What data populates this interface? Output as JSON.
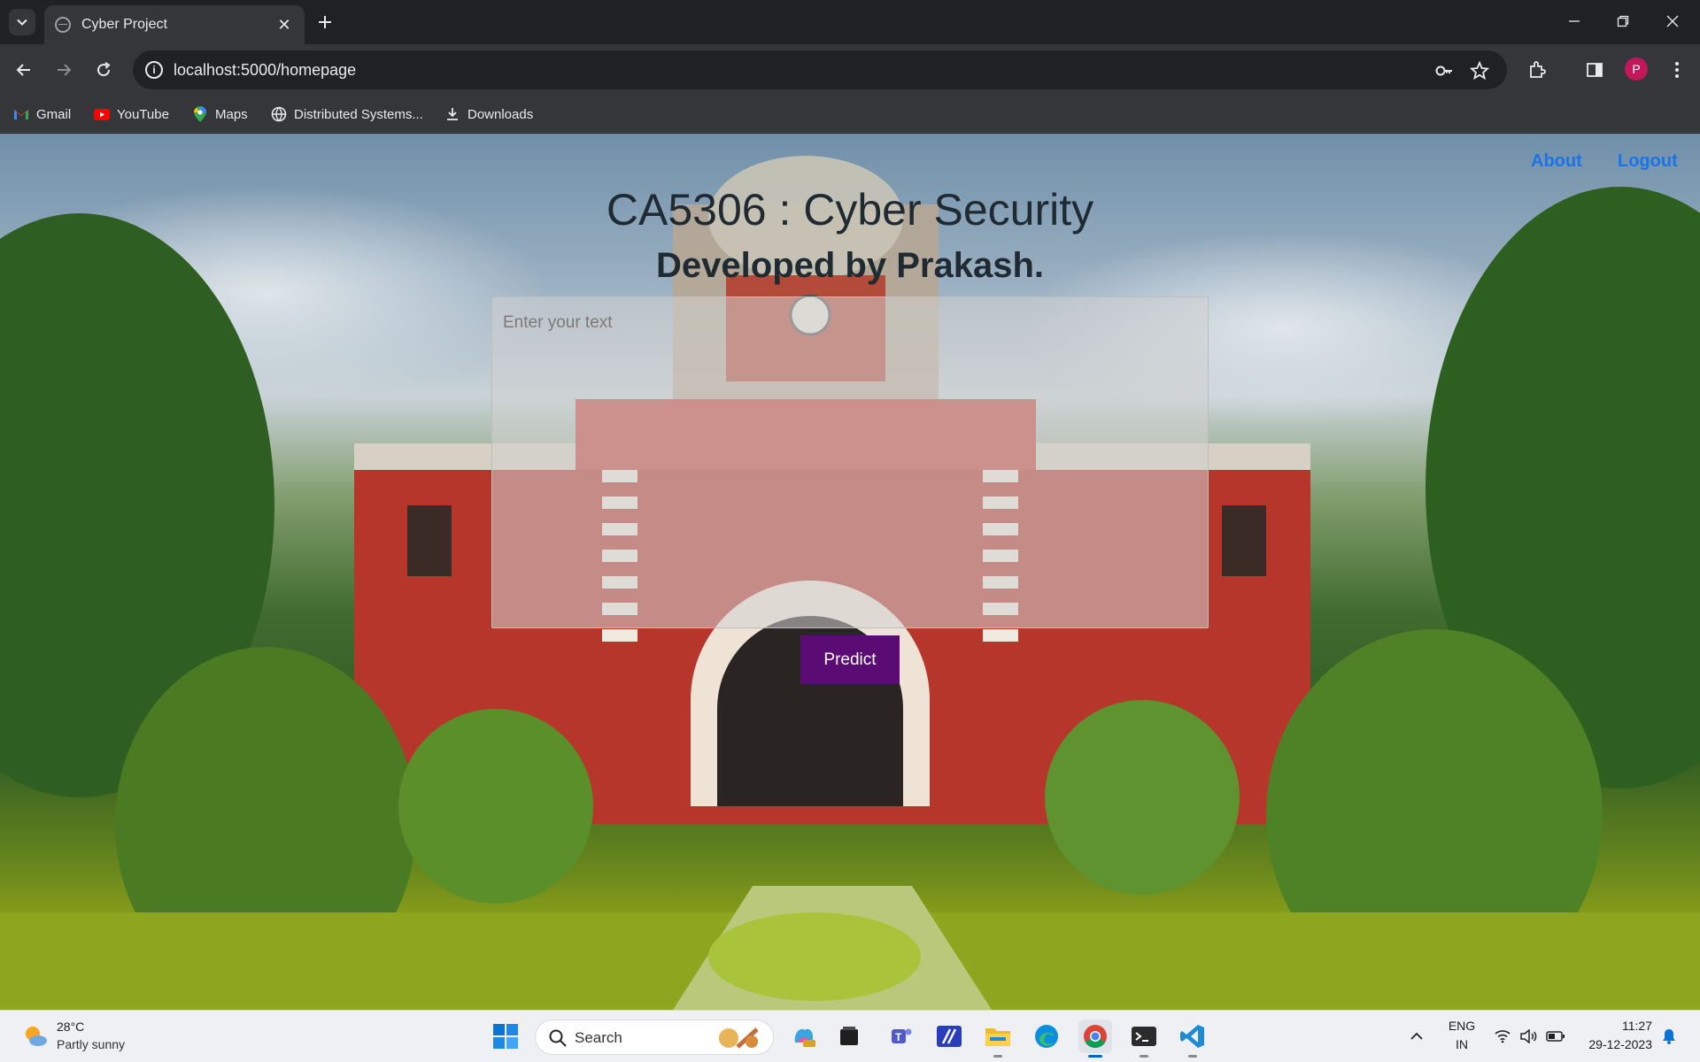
{
  "browser": {
    "tab_title": "Cyber Project",
    "url": "localhost:5000/homepage",
    "profile_initial": "P",
    "bookmarks": [
      {
        "label": "Gmail",
        "icon": "gmail-icon"
      },
      {
        "label": "YouTube",
        "icon": "youtube-icon"
      },
      {
        "label": "Maps",
        "icon": "maps-icon"
      },
      {
        "label": "Distributed Systems...",
        "icon": "globe-icon"
      },
      {
        "label": "Downloads",
        "icon": "download-icon"
      }
    ]
  },
  "page": {
    "nav": {
      "about": "About",
      "logout": "Logout"
    },
    "title": "CA5306 : Cyber Security",
    "subtitle": "Developed by Prakash.",
    "textarea_placeholder": "Enter your text",
    "textarea_value": "",
    "predict_label": "Predict",
    "colors": {
      "link": "#1a73e8",
      "button": "#5b0b74",
      "heading": "#1f2a33"
    }
  },
  "taskbar": {
    "weather": {
      "temp": "28°C",
      "desc": "Partly sunny"
    },
    "search_label": "Search",
    "language": {
      "line1": "ENG",
      "line2": "IN"
    },
    "time": "11:27",
    "date": "29-12-2023"
  }
}
